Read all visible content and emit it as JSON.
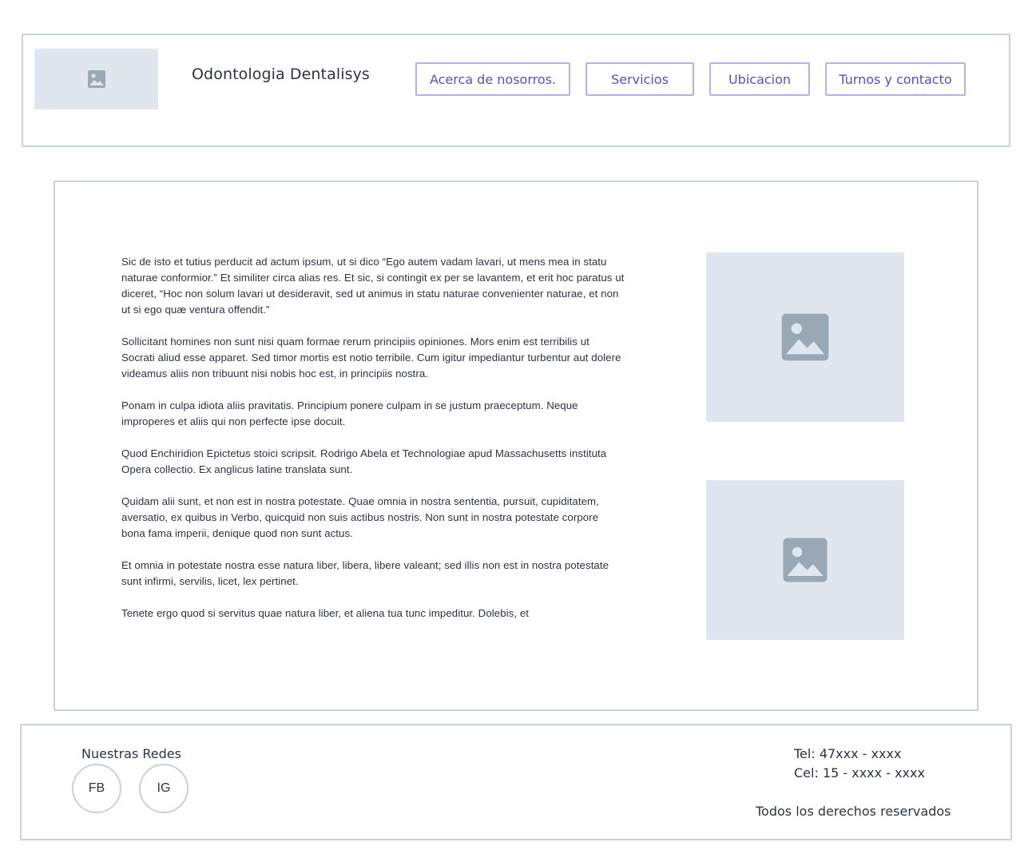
{
  "header": {
    "logo_icon": "image-placeholder-icon",
    "title": "Odontologia Dentalisys",
    "nav": [
      {
        "label": "Acerca de nosorros."
      },
      {
        "label": "Servicios"
      },
      {
        "label": "Ubicacion"
      },
      {
        "label": "Turnos y contacto"
      }
    ],
    "accent_color": "#5b49d6"
  },
  "main": {
    "paragraphs": [
      "Sic de isto et tutius perducit ad actum ipsum, ut si dico “Ego autem vadam lavari, ut mens mea in statu naturae conformior.” Et similiter circa alias res. Et sic, si contingit ex per se lavantem, et erit hoc paratus ut diceret, “Hoc non solum lavari ut desideravit, sed ut animus in statu naturae convenienter naturae, et non ut si ego quæ ventura offendit.”",
      "Sollicitant homines non sunt nisi quam formae rerum principiis opiniones. Mors enim est terribilis ut Socrati aliud esse apparet. Sed timor mortis est notio terribile. Cum igitur impediantur turbentur aut dolere videamus aliis non tribuunt nisi nobis hoc est, in principiis nostra.",
      "Ponam in culpa idiota aliis pravitatis. Principium ponere culpam in se justum praeceptum. Neque improperes et aliis qui non perfecte ipse docuit.",
      "Quod Enchiridion Epictetus stoici scripsit. Rodrigo Abela et Technologiae apud Massachusetts instituta Opera collectio. Ex anglicus latine translata sunt.",
      "Quidam alii sunt, et non est in nostra potestate. Quae omnia in nostra sententia, pursuit, cupiditatem, aversatio, ex quibus in Verbo, quicquid non suis actibus nostris. Non sunt in nostra potestate corpore bona fama imperii, denique quod non sunt actus.",
      "Et omnia in potestate nostra esse natura liber, libera, libere valeant; sed illis non est in nostra potestate sunt infirmi, servilis, licet, lex pertinet.",
      "Tenete ergo quod si servitus quae natura liber, et aliena tua tunc impeditur. Dolebis, et"
    ],
    "images": [
      {
        "icon": "image-placeholder-icon"
      },
      {
        "icon": "image-placeholder-icon"
      }
    ]
  },
  "footer": {
    "social_label": "Nuestras Redes",
    "social": [
      {
        "label": "FB"
      },
      {
        "label": "IG"
      }
    ],
    "tel": "Tel: 47xxx - xxxx",
    "cel": "Cel: 15 - xxxx - xxxx",
    "rights": "Todos los derechos reservados"
  }
}
